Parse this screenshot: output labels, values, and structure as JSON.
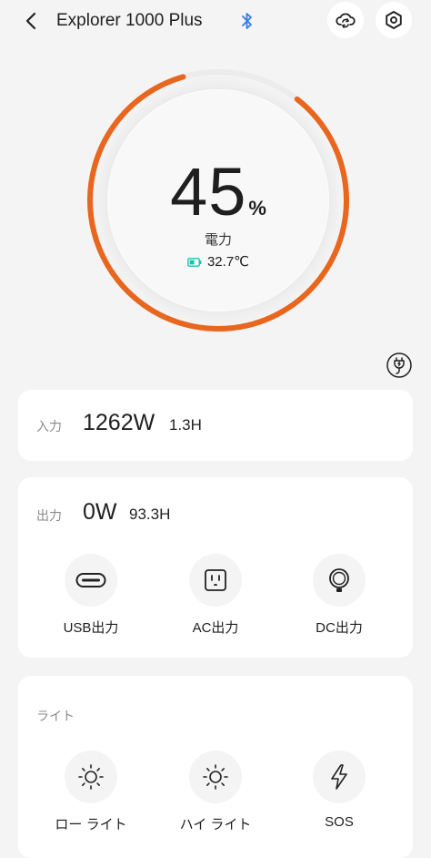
{
  "header": {
    "title": "Explorer 1000 Plus",
    "icons": [
      "back-icon",
      "bluetooth-icon",
      "cloud-sync-icon",
      "settings-icon"
    ]
  },
  "battery": {
    "percent_value": "45",
    "percent_unit": "%",
    "label": "電力",
    "temperature": "32.7℃",
    "level_fraction": 0.45
  },
  "input": {
    "label": "入力",
    "power": "1262W",
    "time": "1.3H"
  },
  "output": {
    "label": "出力",
    "power": "0W",
    "time": "93.3H",
    "buttons": [
      {
        "label": "USB出力",
        "icon": "usb-icon"
      },
      {
        "label": "AC出力",
        "icon": "ac-outlet-icon"
      },
      {
        "label": "DC出力",
        "icon": "dc-outlet-icon"
      }
    ]
  },
  "light": {
    "label": "ライト",
    "buttons": [
      {
        "label": "ロー ライト",
        "icon": "sun-icon"
      },
      {
        "label": "ハイ ライト",
        "icon": "sun-icon"
      },
      {
        "label": "SOS",
        "icon": "lightning-icon"
      }
    ]
  },
  "colors": {
    "accent": "#e8661e",
    "bluetooth": "#2f7fe6",
    "battery": "#18c6b0"
  }
}
